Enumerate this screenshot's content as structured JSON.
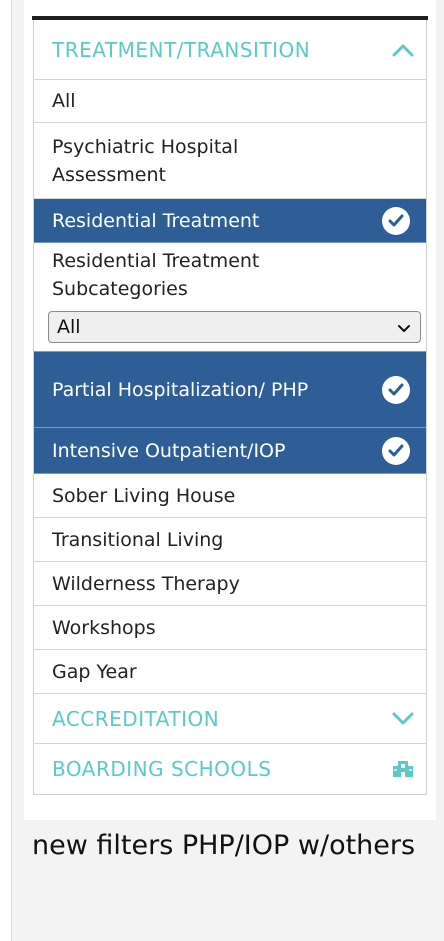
{
  "sections": {
    "treatment": {
      "title": "TREATMENT/TRANSITION",
      "expanded": true
    },
    "accreditation": {
      "title": "ACCREDITATION",
      "expanded": false
    },
    "boarding": {
      "title": "BOARDING SCHOOLS"
    }
  },
  "items": [
    {
      "label": "All",
      "selected": false
    },
    {
      "label": "Psychiatric Hospital Assessment",
      "selected": false
    },
    {
      "label": "Residential Treatment",
      "selected": true
    },
    {
      "label": "Residential Treatment Subcategories",
      "selected": false
    },
    {
      "label": "Partial Hospitalization/ PHP",
      "selected": true
    },
    {
      "label": "Intensive Outpatient/IOP",
      "selected": true
    },
    {
      "label": "Sober Living House",
      "selected": false
    },
    {
      "label": "Transitional Living",
      "selected": false
    },
    {
      "label": "Wilderness Therapy",
      "selected": false
    },
    {
      "label": "Workshops",
      "selected": false
    },
    {
      "label": "Gap Year",
      "selected": false
    }
  ],
  "subcategory_select": {
    "value": "All"
  },
  "caption": "new filters PHP/IOP w/others",
  "colors": {
    "accent": "#5cc9c7",
    "selected_bg": "#2f5e96",
    "text": "#222222"
  },
  "icons": {
    "chevron_up": "chevron-up-icon",
    "chevron_down": "chevron-down-icon",
    "check": "check-circle-icon",
    "school": "school-icon"
  }
}
